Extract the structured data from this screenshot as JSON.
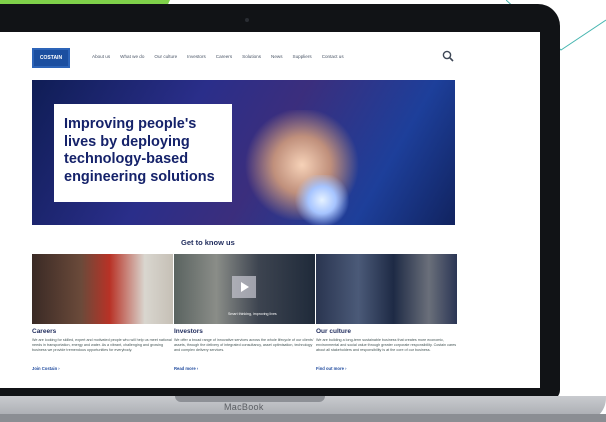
{
  "site": {
    "logo_text": "COSTAIN",
    "nav": [
      "About us",
      "What we do",
      "Our culture",
      "Investors",
      "Careers",
      "Solutions",
      "News",
      "Suppliers",
      "Contact us"
    ],
    "search_icon": "search-icon",
    "hero_title": "Improving people's lives by deploying technology-based engineering solutions",
    "section_title": "Get to know us",
    "cards": [
      {
        "heading": "Careers",
        "body": "We are looking for skilled, expert and motivated people who will help us meet national needs in transportation, energy and water. As a vibrant, challenging and growing business we provide tremendous opportunities for everybody.",
        "link": "Join Costain ›"
      },
      {
        "heading": "Investors",
        "body": "We offer a broad range of innovative services across the whole lifecycle of our clients' assets, through the delivery of integrated consultancy, asset optimisation, technology and complex delivery services.",
        "link": "Read more ›",
        "video_caption": "Smart thinking, improving lives"
      },
      {
        "heading": "Our culture",
        "body": "We are building a long-term sustainable business that creates more economic, environmental and social value through greater corporate responsibility. Costain cares about all stakeholders and responsibility is at the core of our business.",
        "link": "Find out more ›"
      }
    ]
  },
  "device": {
    "brand": "MacBook"
  },
  "colors": {
    "accent_green": "#7fd14a",
    "navy": "#15226a",
    "link_blue": "#1f4a9e"
  }
}
